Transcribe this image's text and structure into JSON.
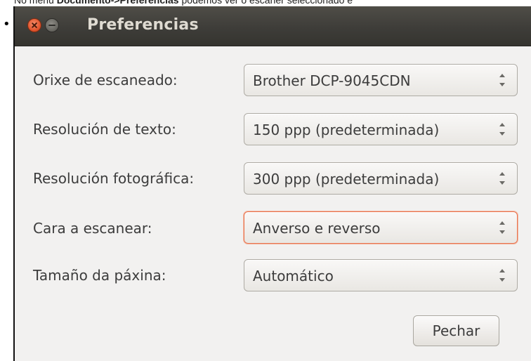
{
  "caption": {
    "prefix": "No menú ",
    "menu_path": "Documento->Preferencias",
    "suffix": " podemos ver o escaner seleccionado e"
  },
  "bullet": "•",
  "window": {
    "title": "Preferencias",
    "rows": [
      {
        "label": "Orixe de escaneado:",
        "value": "Brother DCP-9045CDN"
      },
      {
        "label": "Resolución de texto:",
        "value": "150 ppp (predeterminada)"
      },
      {
        "label": "Resolución fotográfica:",
        "value": "300 ppp (predeterminada)"
      },
      {
        "label": "Cara a escanear:",
        "value": "Anverso e reverso"
      },
      {
        "label": "Tamaño da páxina:",
        "value": "Automático"
      }
    ],
    "close_label": "Pechar"
  },
  "colors": {
    "titlebar": "#3e3d39",
    "dialog_bg": "#f2f1f0",
    "focus_border": "#e8744f",
    "close_button": "#e1552e"
  },
  "icons": {
    "window_close": "close-icon",
    "window_minimize": "minimize-icon",
    "combo_spinner": "spinner-arrows-icon"
  }
}
